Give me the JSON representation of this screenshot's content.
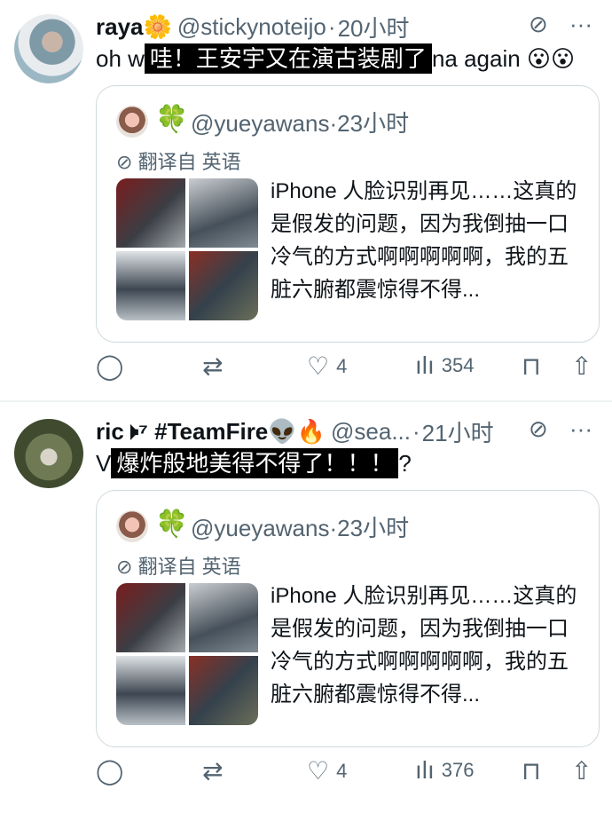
{
  "tweets": [
    {
      "author_name": "raya🌼",
      "handle": "@stickynoteijo",
      "time": "20小时",
      "text_before": "oh w",
      "text_censored": "哇！王安宇又在演古装剧了",
      "text_after": "na again 😮😮",
      "quote": {
        "handle": "@yueyawans",
        "time": "23小时",
        "translate_label": "翻译自 英语",
        "text": "iPhone 人脸识别再见……这真的是假发的问题，因为我倒抽一口冷气的方式啊啊啊啊啊，我的五脏六腑都震惊得不得..."
      },
      "actions": {
        "replies": "",
        "retweets": "",
        "likes": "4",
        "views": "354"
      }
    },
    {
      "author_name": "ric🕨⁷ #TeamFire👽🔥",
      "handle": "@sea...",
      "time": "21小时",
      "text_before": "V",
      "text_censored": "爆炸般地美得不得了！！！",
      "text_after": "?",
      "quote": {
        "handle": "@yueyawans",
        "time": "23小时",
        "translate_label": "翻译自 英语",
        "text": "iPhone 人脸识别再见……这真的是假发的问题，因为我倒抽一口冷气的方式啊啊啊啊啊，我的五脏六腑都震惊得不得..."
      },
      "actions": {
        "replies": "",
        "retweets": "",
        "likes": "4",
        "views": "376"
      }
    }
  ],
  "icons": {
    "grok": "⊘",
    "more": "···",
    "reply": "◯",
    "retweet": "⇄",
    "like": "♡",
    "views": "ılı",
    "bookmark": "⊓",
    "share": "⇧",
    "clover": "🍀"
  },
  "colors": {
    "text": "#0f1419",
    "muted": "#536471",
    "border": "#cfd9de",
    "separator": "#eff3f4"
  }
}
